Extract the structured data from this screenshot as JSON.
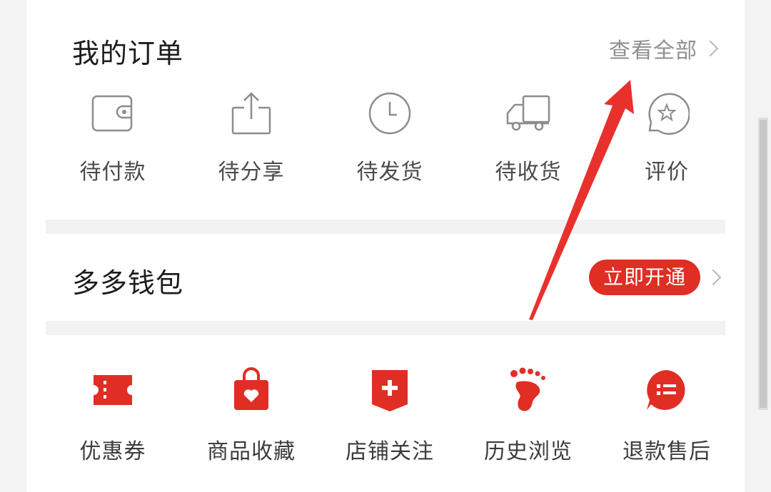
{
  "orders": {
    "title": "我的订单",
    "view_all": "查看全部",
    "items": [
      {
        "label": "待付款",
        "icon": "wallet-icon"
      },
      {
        "label": "待分享",
        "icon": "share-icon"
      },
      {
        "label": "待发货",
        "icon": "clock-icon"
      },
      {
        "label": "待收货",
        "icon": "truck-icon"
      },
      {
        "label": "评价",
        "icon": "review-star-icon"
      }
    ]
  },
  "wallet": {
    "title": "多多钱包",
    "open_label": "立即开通"
  },
  "tools": {
    "items": [
      {
        "label": "优惠券",
        "icon": "coupon-icon"
      },
      {
        "label": "商品收藏",
        "icon": "favorite-bag-icon"
      },
      {
        "label": "店铺关注",
        "icon": "store-follow-icon"
      },
      {
        "label": "历史浏览",
        "icon": "footprint-icon"
      },
      {
        "label": "退款售后",
        "icon": "refund-icon"
      }
    ]
  },
  "colors": {
    "accent": "#e02e24",
    "icon_gray": "#8c8c8c",
    "annotation_arrow": "#e8312d"
  }
}
